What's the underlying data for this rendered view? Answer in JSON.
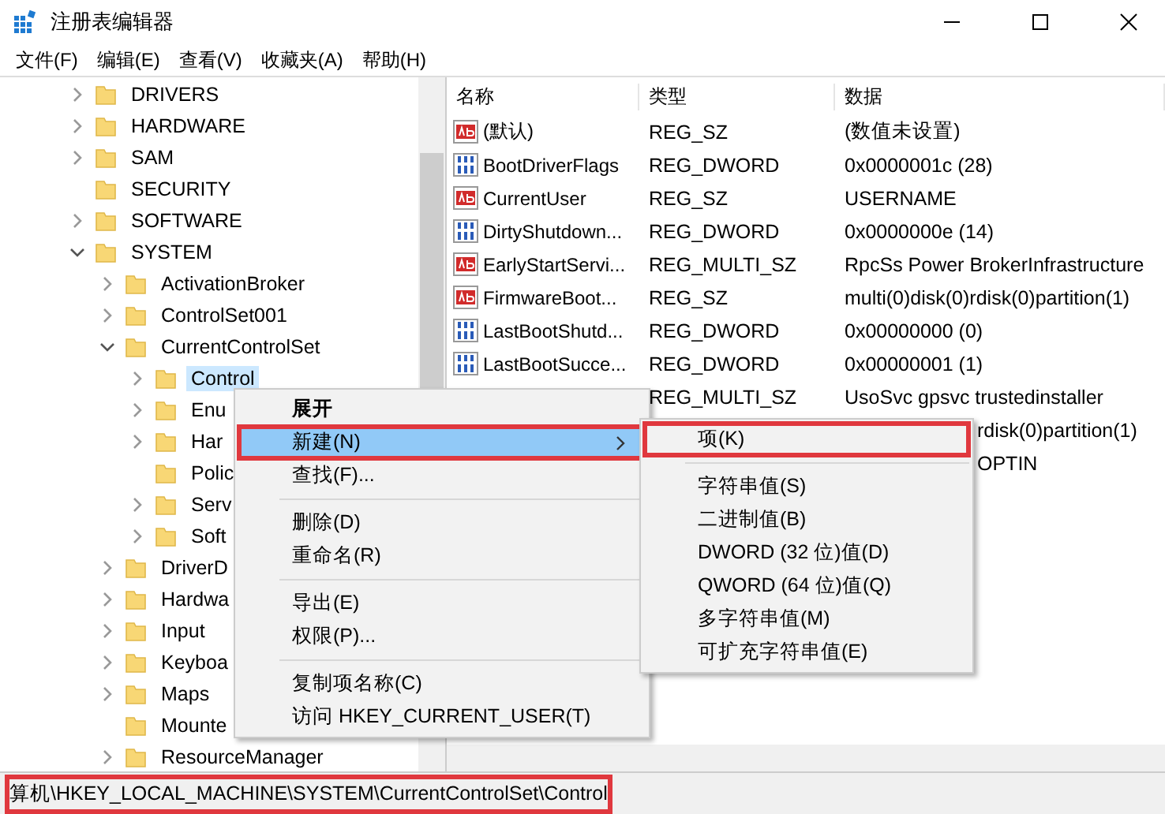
{
  "window": {
    "title": "注册表编辑器"
  },
  "menu_bar": [
    "文件(F)",
    "编辑(E)",
    "查看(V)",
    "收藏夹(A)",
    "帮助(H)"
  ],
  "tree": [
    {
      "label": "DRIVERS",
      "kind": "node",
      "expanded": false,
      "selected": false
    },
    {
      "label": "HARDWARE",
      "kind": "node",
      "expanded": false,
      "selected": false
    },
    {
      "label": "SAM",
      "kind": "node",
      "expanded": false,
      "selected": false
    },
    {
      "label": "SECURITY",
      "kind": "leaf",
      "selected": false
    },
    {
      "label": "SOFTWARE",
      "kind": "node",
      "expanded": false,
      "selected": false
    },
    {
      "label": "SYSTEM",
      "kind": "node",
      "expanded": true,
      "selected": false,
      "children": [
        {
          "label": "ActivationBroker",
          "kind": "node",
          "expanded": false,
          "selected": false
        },
        {
          "label": "ControlSet001",
          "kind": "node",
          "expanded": false,
          "selected": false
        },
        {
          "label": "CurrentControlSet",
          "kind": "node",
          "expanded": true,
          "selected": false,
          "children": [
            {
              "label": "Control",
              "kind": "node",
              "expanded": false,
              "selected": true
            },
            {
              "label": "Enu",
              "kind": "node",
              "expanded": false,
              "selected": false
            },
            {
              "label": "Har",
              "kind": "node",
              "expanded": false,
              "selected": false
            },
            {
              "label": "Polic",
              "kind": "leaf",
              "selected": false
            },
            {
              "label": "Serv",
              "kind": "node",
              "expanded": false,
              "selected": false
            },
            {
              "label": "Soft",
              "kind": "node",
              "expanded": false,
              "selected": false
            }
          ]
        },
        {
          "label": "DriverD",
          "kind": "node",
          "expanded": false,
          "selected": false
        },
        {
          "label": "Hardwa",
          "kind": "node",
          "expanded": false,
          "selected": false
        },
        {
          "label": "Input",
          "kind": "node",
          "expanded": false,
          "selected": false
        },
        {
          "label": "Keyboa",
          "kind": "node",
          "expanded": false,
          "selected": false
        },
        {
          "label": "Maps",
          "kind": "node",
          "expanded": false,
          "selected": false
        },
        {
          "label": "Mounte",
          "kind": "leaf",
          "selected": false
        },
        {
          "label": "ResourceManager",
          "kind": "node",
          "expanded": false,
          "selected": false
        }
      ]
    }
  ],
  "table": {
    "columns": [
      "名称",
      "类型",
      "数据"
    ],
    "rows": [
      {
        "kind": "string",
        "name": "(默认)",
        "type": "REG_SZ",
        "data": "(数值未设置)"
      },
      {
        "kind": "binary",
        "name": "BootDriverFlags",
        "type": "REG_DWORD",
        "data": "0x0000001c (28)"
      },
      {
        "kind": "string",
        "name": "CurrentUser",
        "type": "REG_SZ",
        "data": "USERNAME"
      },
      {
        "kind": "binary",
        "name": "DirtyShutdown...",
        "type": "REG_DWORD",
        "data": "0x0000000e (14)"
      },
      {
        "kind": "string",
        "name": "EarlyStartServi...",
        "type": "REG_MULTI_SZ",
        "data": "RpcSs Power BrokerInfrastructure"
      },
      {
        "kind": "string",
        "name": "FirmwareBoot...",
        "type": "REG_SZ",
        "data": "multi(0)disk(0)rdisk(0)partition(1)"
      },
      {
        "kind": "binary",
        "name": "LastBootShutd...",
        "type": "REG_DWORD",
        "data": "0x00000000 (0)"
      },
      {
        "kind": "binary",
        "name": "LastBootSucce...",
        "type": "REG_DWORD",
        "data": "0x00000001 (1)"
      },
      {
        "type": "REG_MULTI_SZ",
        "data": "UsoSvc gpsvc trustedinstaller"
      },
      {
        "covered": true,
        "data": "rdisk(0)partition(1)"
      },
      {
        "covered": true,
        "data": "OPTIN"
      }
    ]
  },
  "context_menu": [
    {
      "kind": "item",
      "label": "展开",
      "default": true,
      "selected": false,
      "submenu": false,
      "annotated": false
    },
    {
      "kind": "item",
      "label": "新建(N)",
      "default": false,
      "selected": true,
      "submenu": true,
      "annotated": true
    },
    {
      "kind": "item",
      "label": "查找(F)...",
      "default": false,
      "selected": false,
      "submenu": false,
      "annotated": false
    },
    {
      "kind": "separator"
    },
    {
      "kind": "item",
      "label": "删除(D)",
      "default": false,
      "selected": false,
      "submenu": false,
      "annotated": false
    },
    {
      "kind": "item",
      "label": "重命名(R)",
      "default": false,
      "selected": false,
      "submenu": false,
      "annotated": false
    },
    {
      "kind": "separator"
    },
    {
      "kind": "item",
      "label": "导出(E)",
      "default": false,
      "selected": false,
      "submenu": false,
      "annotated": false
    },
    {
      "kind": "item",
      "label": "权限(P)...",
      "default": false,
      "selected": false,
      "submenu": false,
      "annotated": false
    },
    {
      "kind": "separator"
    },
    {
      "kind": "item",
      "label": "复制项名称(C)",
      "default": false,
      "selected": false,
      "submenu": false,
      "annotated": false
    },
    {
      "kind": "item",
      "label": "访问 HKEY_CURRENT_USER(T)",
      "default": false,
      "selected": false,
      "submenu": false,
      "annotated": false
    }
  ],
  "submenu": [
    {
      "kind": "item",
      "label": "项(K)",
      "annotated": true
    },
    {
      "kind": "separator"
    },
    {
      "kind": "item",
      "label": "字符串值(S)",
      "annotated": false
    },
    {
      "kind": "item",
      "label": "二进制值(B)",
      "annotated": false
    },
    {
      "kind": "item",
      "label": "DWORD (32 位)值(D)",
      "annotated": false
    },
    {
      "kind": "item",
      "label": "QWORD (64 位)值(Q)",
      "annotated": false
    },
    {
      "kind": "item",
      "label": "多字符串值(M)",
      "annotated": false
    },
    {
      "kind": "item",
      "label": "可扩充字符串值(E)",
      "annotated": false
    }
  ],
  "status_bar": {
    "text": "算机\\HKEY_LOCAL_MACHINE\\SYSTEM\\CurrentControlSet\\Control",
    "annotated": true
  }
}
